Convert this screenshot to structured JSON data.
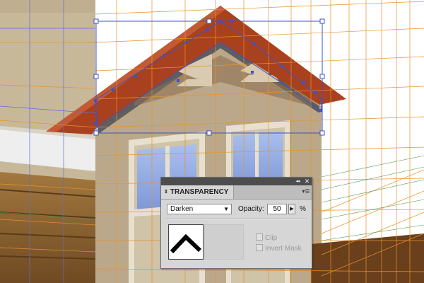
{
  "artwork": {
    "colors": {
      "roof": "#a9411f",
      "wall": "#bba88a",
      "left_wall": "#c8b89a",
      "window_frame": "#e8e0cf",
      "glass": "#8fa9e0",
      "guide_orange": "#e8922a",
      "guide_green": "#4f9a4f",
      "guide_blue": "#5a6ee0",
      "selection": "#3d52c9"
    },
    "selection_anchor_count": 16
  },
  "transparency_panel": {
    "collapse_icon": "◂◂",
    "close_icon": "✕",
    "tab_arrows_icon": "⇕",
    "tab_label": "TRANSPARENCY",
    "menu_icon": "▾☰",
    "blend_mode": "Darken",
    "blend_dropdown_icon": "▼",
    "opacity_label": "Opacity:",
    "opacity_value": "50",
    "opacity_stepper_icon": "▶",
    "percent_sign": "%",
    "clip_label": "Clip",
    "invert_mask_label": "Invert Mask",
    "clip_checked": false,
    "invert_mask_checked": false,
    "clip_enabled": false,
    "invert_mask_enabled": false
  }
}
